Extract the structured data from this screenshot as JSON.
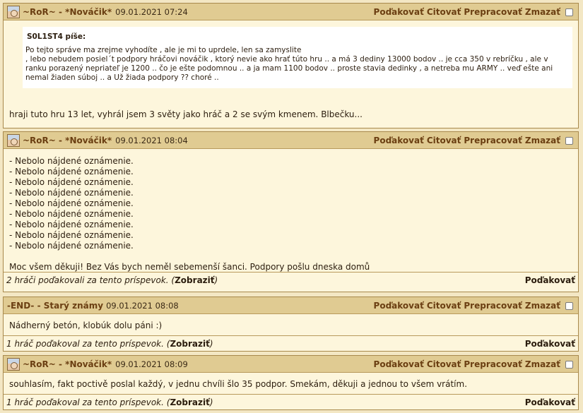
{
  "posts": [
    {
      "author": "~RoR~ - *Nováčik*",
      "date": "09.01.2021 07:24",
      "actions": [
        "Poďakovať",
        "Citovať",
        "Prepracovať",
        "Zmazať"
      ],
      "quote": {
        "author": "S0L1ST4 píše:",
        "text": "Po tejto správe ma zrejme vyhodíte , ale je mi to uprdele, len sa zamyslite\n, lebo nebudem posiel´t podpory hráčovi nováčik , ktorý nevie ako hrať túto hru .. a má 3 dediny 13000 bodov .. je cca 350 v rebríčku , ale v ranku porazený nepriateľ je 1200 .. čo je ešte podomnou .. a ja mam 1100 bodov .. proste stavia dedinky , a netreba mu ARMY .. veď ešte ani nemal žiaden súboj .. a Už žiada podpory ?? choré .."
      },
      "body": "hraji tuto hru 13 let, vyhrál jsem 3 světy jako hráč a 2 se svým kmenem. Blbečku..."
    },
    {
      "author": "~RoR~ - *Nováčik*",
      "date": "09.01.2021 08:04",
      "actions": [
        "Poďakovať",
        "Citovať",
        "Prepracovať",
        "Zmazať"
      ],
      "lines": [
        "- Nebolo nájdené oznámenie.",
        "- Nebolo nájdené oznámenie.",
        "- Nebolo nájdené oznámenie.",
        "- Nebolo nájdené oznámenie.",
        "- Nebolo nájdené oznámenie.",
        "- Nebolo nájdené oznámenie.",
        "- Nebolo nájdené oznámenie.",
        "- Nebolo nájdené oznámenie.",
        "- Nebolo nájdené oznámenie."
      ],
      "body": "Moc všem děkuji! Bez Vás bych neměl sebemenší šanci. Podpory pošlu dneska domů",
      "footer": {
        "text": "2 hráči poďakovali za tento príspevok. (",
        "link": "Zobraziť",
        "close": ")",
        "thank": "Poďakovať"
      }
    },
    {
      "author": "-END- - Starý známy",
      "date": "09.01.2021 08:08",
      "actions": [
        "Poďakovať",
        "Citovať",
        "Prepracovať",
        "Zmazať"
      ],
      "body": "Nádherný betón, klobúk dolu páni :)",
      "footer": {
        "text": "1 hráč poďakoval za tento príspevok. (",
        "link": "Zobraziť",
        "close": ")",
        "thank": "Poďakovať"
      }
    },
    {
      "author": "~RoR~ - *Nováčik*",
      "date": "09.01.2021 08:09",
      "actions": [
        "Poďakovať",
        "Citovať",
        "Prepracovať",
        "Zmazať"
      ],
      "body": "souhlasím, fakt poctivě poslal každý, v jednu chvíli šlo 35 podpor. Smekám, děkuji a jednou to všem vrátím.",
      "footer": {
        "text": "1 hráč poďakoval za tento príspevok. (",
        "link": "Zobraziť",
        "close": ")",
        "thank": "Poďakovať"
      }
    }
  ]
}
